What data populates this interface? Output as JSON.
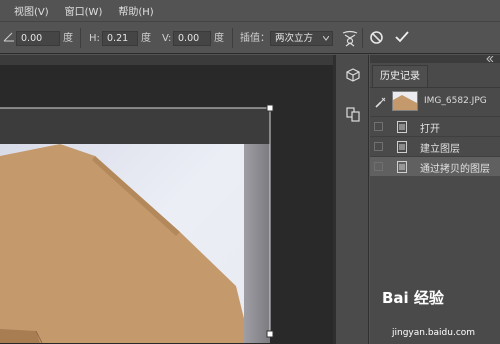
{
  "menu": {
    "items": [
      "视图(V)",
      "窗口(W)",
      "帮助(H)"
    ]
  },
  "options": {
    "angle_value": "0.00",
    "angle_unit": "度",
    "h_label": "H:",
    "h_value": "0.21",
    "h_unit": "度",
    "v_label": "V:",
    "v_value": "0.00",
    "v_unit": "度",
    "interp_label": "插值：",
    "interp_value": "两次立方"
  },
  "history_panel": {
    "tab_label": "历史记录",
    "snapshot_name": "IMG_6582.JPG",
    "items": [
      {
        "label": "打开",
        "active": false
      },
      {
        "label": "建立图层",
        "active": false
      },
      {
        "label": "通过拷贝的图层",
        "active": true
      }
    ]
  },
  "watermark": {
    "logo_text": "Bai 经验",
    "url": "jingyan.baidu.com"
  },
  "colors": {
    "cardboard": "#c49a6c",
    "cardboard_dark": "#b3885b",
    "paper": "#e8eaf2",
    "panel_bg": "#4a4a4a",
    "active_row": "#606060"
  }
}
